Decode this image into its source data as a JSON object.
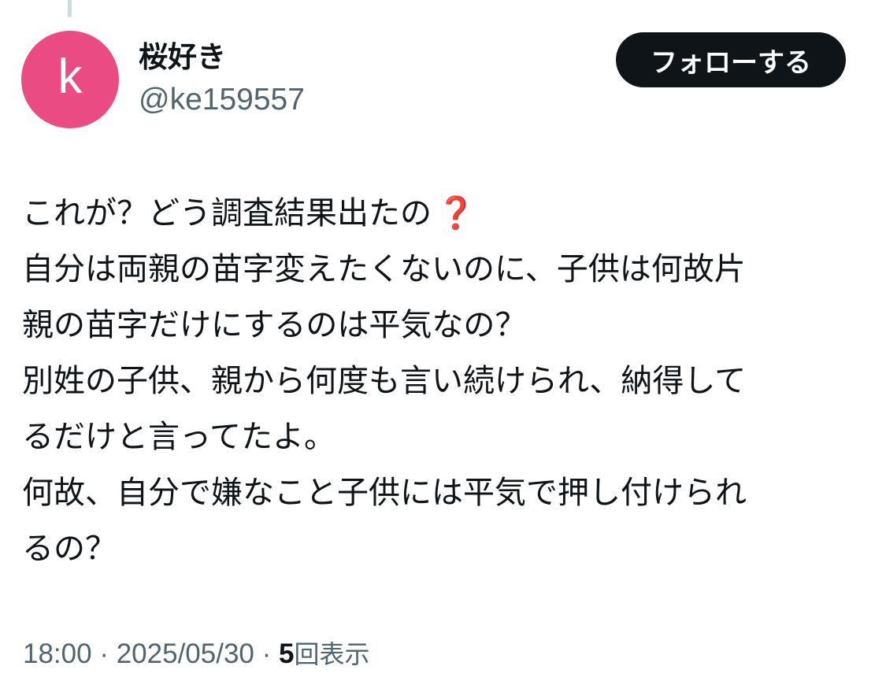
{
  "tweet": {
    "author": {
      "display_name": "桜好き",
      "handle": "@ke159557",
      "avatar_letter": "k",
      "avatar_color": "#e94b82"
    },
    "follow_label": "フォローする",
    "lines": [
      "これが？どう調査結果出たの",
      "自分は両親の苗字変えたくないのに、子供は何故片",
      "親の苗字だけにするのは平気なの？",
      "別姓の子供、親から何度も言い続けられ、納得して",
      "るだけと言ってたよ。",
      "何故、自分で嫌なこと子供には平気で押し付けられ",
      "るの？"
    ],
    "line0_emoji": "❓",
    "emoji_name": "red-question-mark-icon",
    "time": "18:00",
    "separator": "·",
    "date": "2025/05/30",
    "view_count": "5",
    "view_label": "回表示"
  },
  "colors": {
    "text": "#0f1419",
    "secondary": "#536471",
    "button_bg": "#0f1419",
    "thread_line": "#cfd9de"
  }
}
